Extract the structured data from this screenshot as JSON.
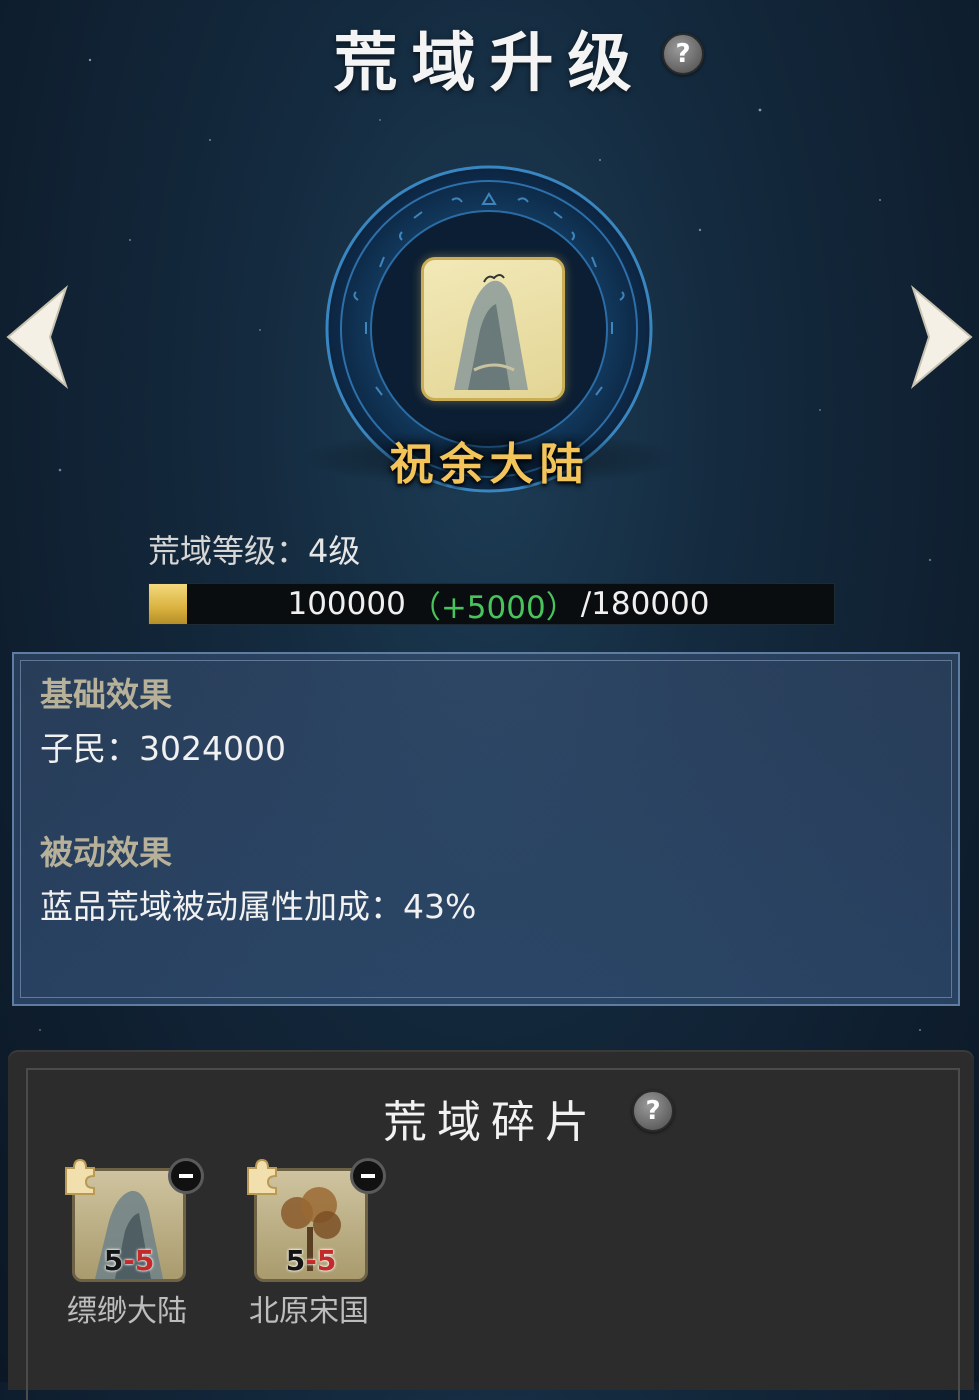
{
  "header": {
    "title": "荒域升级",
    "help_icon": "?"
  },
  "region": {
    "name": "祝余大陆",
    "emblem_icon": "mountain-icon"
  },
  "level": {
    "label": "荒域等级：",
    "value": "4级"
  },
  "progress": {
    "current": "100000",
    "gain": "（+5000）",
    "max": "/180000",
    "fraction": 0.056,
    "fill_color": "#d9b23f"
  },
  "effects": {
    "basic_title": "基础效果",
    "basic_line": "子民：3024000",
    "passive_title": "被动效果",
    "passive_line": "蓝品荒域被动属性加成：43%"
  },
  "fragments": {
    "title": "荒域碎片",
    "help_icon": "?",
    "items": [
      {
        "name": "缥缈大陆",
        "level_left": "5",
        "level_sep": "-",
        "level_right": "5",
        "art": "mountain-icon"
      },
      {
        "name": "北原宋国",
        "level_left": "5",
        "level_sep": "-",
        "level_right": "5",
        "art": "tree-icon"
      }
    ]
  }
}
